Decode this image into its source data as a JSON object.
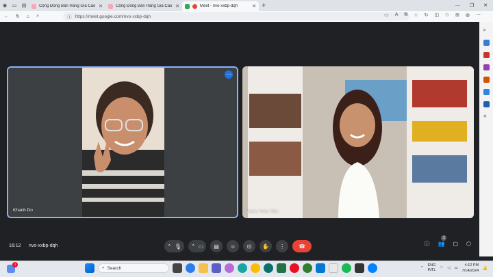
{
  "browser": {
    "tabs": [
      {
        "title": "Cộng Đồng Bán Hàng Giá Cao",
        "active": false,
        "favicon_color": "#f5a8b8"
      },
      {
        "title": "Cộng Đồng Bán Hàng Giá Cao",
        "active": false,
        "favicon_color": "#f5a8b8"
      },
      {
        "title": "Meet - nvo-xxbp-dqh",
        "active": true,
        "favicon_color": "#34a853"
      }
    ],
    "new_tab": "+",
    "url": "https://meet.google.com/nvo-xxbp-dqh"
  },
  "meet": {
    "participants": [
      {
        "name": "Khanh Do",
        "active_speaker": true
      },
      {
        "name": "Anna Thủy Tiên",
        "active_speaker": false
      }
    ],
    "time": "16:12",
    "code": "nvo-xxbp-dqh",
    "people_count": "2",
    "accent": "#8ab4f8",
    "end_color": "#ea4335"
  },
  "taskbar": {
    "search_placeholder": "Search",
    "lang_line1": "ENG",
    "lang_line2": "INTL",
    "time": "4:12 PM",
    "date": "7/14/2024",
    "notification_count": "1"
  }
}
